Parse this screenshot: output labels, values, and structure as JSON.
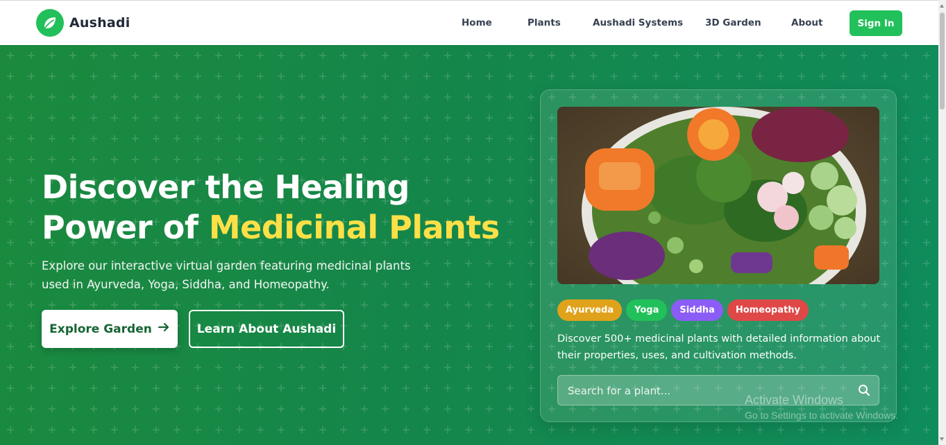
{
  "brand": {
    "name": "Aushadi"
  },
  "nav": {
    "links": [
      "Home",
      "Plants",
      "Aushadi Systems",
      "3D Garden",
      "About"
    ],
    "signin": "Sign In"
  },
  "hero": {
    "title_line1": "Discover the Healing",
    "title_line2_prefix": "Power of ",
    "title_highlight": "Medicinal Plants",
    "subtitle_line1": "Explore our interactive virtual garden featuring medicinal plants",
    "subtitle_line2": "used in Ayurveda, Yoga, Siddha, and Homeopathy.",
    "explore_button": "Explore Garden",
    "learn_button": "Learn About Aushadi"
  },
  "card": {
    "tags": [
      {
        "label": "Ayurveda",
        "color": "#e0a21a"
      },
      {
        "label": "Yoga",
        "color": "#22c05a"
      },
      {
        "label": "Siddha",
        "color": "#8b5cf6"
      },
      {
        "label": "Homeopathy",
        "color": "#e04848"
      }
    ],
    "text_line1": "Discover 500+ medicinal plants with detailed information about",
    "text_line2": "their properties, uses, and cultivation methods.",
    "search_placeholder": "Search for a plant..."
  },
  "watermark": {
    "line1": "Activate Windows",
    "line2": "Go to Settings to activate Windows."
  },
  "colors": {
    "brand_green": "#22c05a",
    "hero_green": "#15864a",
    "highlight_yellow": "#fde047"
  }
}
